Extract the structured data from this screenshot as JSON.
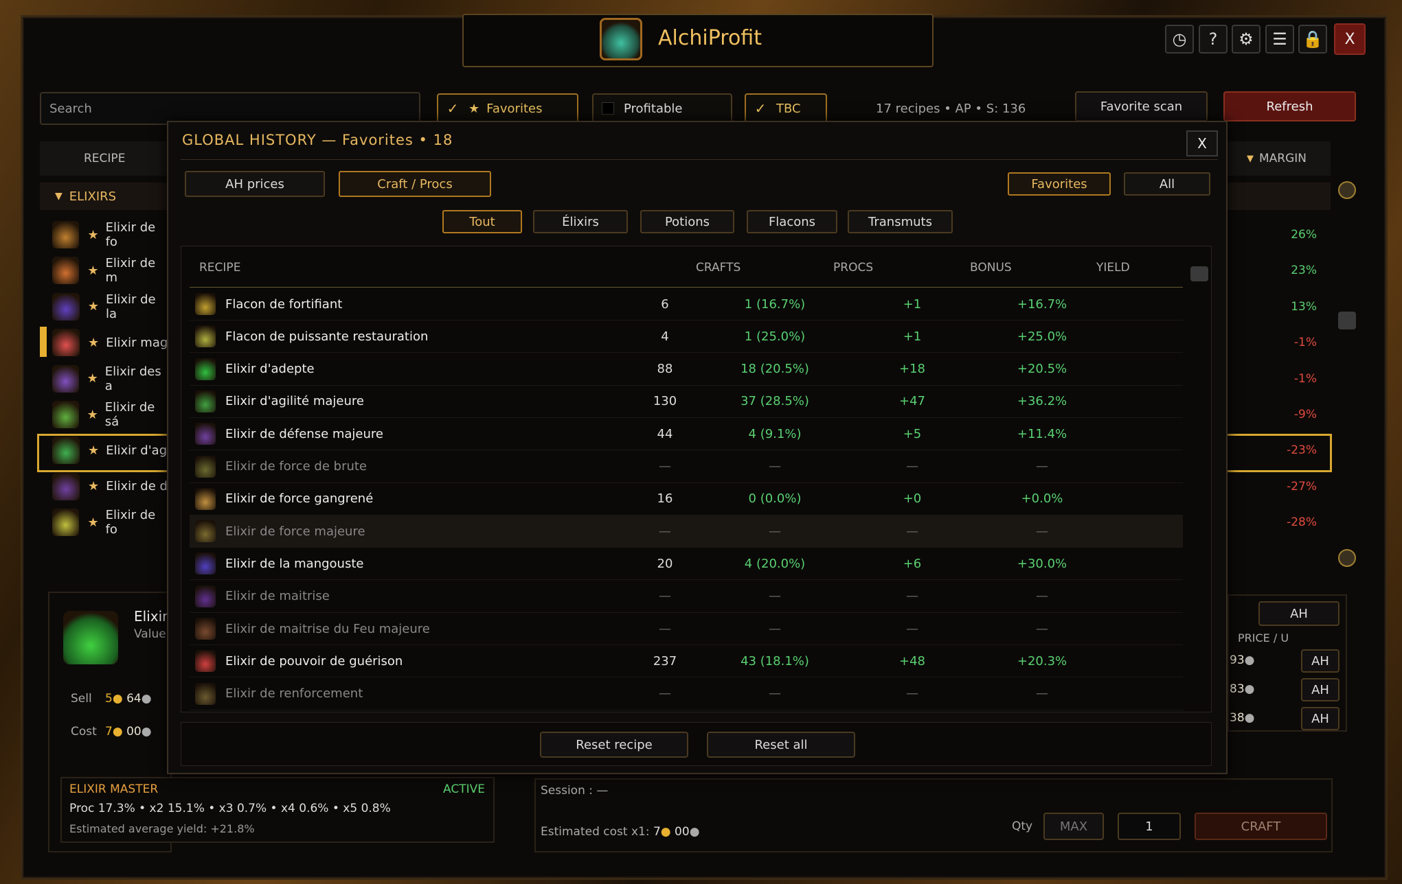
{
  "app": {
    "title": "AlchiProfit",
    "close": "X"
  },
  "toolbar": {
    "search_placeholder": "Search",
    "favorites": "Favorites",
    "profitable": "Profitable",
    "tbc": "TBC",
    "meta": "17 recipes  •  AP  •  S: 136",
    "favorite_scan": "Favorite scan",
    "refresh": "Refresh"
  },
  "list": {
    "col_recipe": "RECIPE",
    "col_margin": "MARGIN",
    "category": "ELIXIRS",
    "items": [
      {
        "label": "Elixir de fo",
        "margin": "26%",
        "icon": "#c08030"
      },
      {
        "label": "Elixir de m",
        "margin": "23%",
        "icon": "#d07030"
      },
      {
        "label": "Elixir de la",
        "margin": "13%",
        "icon": "#6040c0"
      },
      {
        "label": "Elixir mag",
        "margin": "-1%",
        "icon": "#e05050"
      },
      {
        "label": "Elixir des a",
        "margin": "-1%",
        "icon": "#8050c0"
      },
      {
        "label": "Elixir de sá",
        "margin": "-9%",
        "icon": "#60b040"
      },
      {
        "label": "Elixir d'ag",
        "margin": "-23%",
        "icon": "#40b050"
      },
      {
        "label": "Elixir de d",
        "margin": "-27%",
        "icon": "#7040a0"
      },
      {
        "label": "Elixir de fo",
        "margin": "-28%",
        "icon": "#c0c040"
      }
    ]
  },
  "detail": {
    "name": "Elixir",
    "value": "Value",
    "sell_label": "Sell",
    "sell_g": "5",
    "sell_s": "64",
    "cost_label": "Cost",
    "cost_g": "7",
    "cost_s": "00",
    "ah": "AH",
    "price_u": "PRICE / U",
    "prices": [
      "93",
      "83",
      "38"
    ],
    "ah_btn": "AH",
    "master": "ELIXIR MASTER",
    "active": "ACTIVE",
    "procs": "Proc 17.3%  •  x2 15.1%  •  x3 0.7%  •  x4 0.6%  •  x5 0.8%",
    "yield": "Estimated average yield: +21.8%",
    "session": "Session : —",
    "est_cost": "Estimated cost x1:",
    "est_g": "7",
    "est_s": "00",
    "qty": "Qty",
    "max": "MAX",
    "qty_val": "1",
    "craft": "CRAFT"
  },
  "modal": {
    "title": "GLOBAL HISTORY  —  Favorites  •  18",
    "close": "X",
    "tabs": [
      "AH prices",
      "Craft / Procs"
    ],
    "scope": [
      "Favorites",
      "All"
    ],
    "filters": [
      "Tout",
      "Élixirs",
      "Potions",
      "Flacons",
      "Transmuts"
    ],
    "cols": [
      "RECIPE",
      "CRAFTS",
      "PROCS",
      "BONUS",
      "YIELD"
    ],
    "rows": [
      {
        "name": "Flacon de fortifiant",
        "crafts": "6",
        "procs": "1 (16.7%)",
        "bonus": "+1",
        "yield": "+16.7%",
        "icon": "#c0a030",
        "dim": false
      },
      {
        "name": "Flacon de puissante restauration",
        "crafts": "4",
        "procs": "1 (25.0%)",
        "bonus": "+1",
        "yield": "+25.0%",
        "icon": "#b0b040",
        "dim": false
      },
      {
        "name": "Elixir d'adepte",
        "crafts": "88",
        "procs": "18 (20.5%)",
        "bonus": "+18",
        "yield": "+20.5%",
        "icon": "#30c040",
        "dim": false
      },
      {
        "name": "Elixir d'agilité majeure",
        "crafts": "130",
        "procs": "37 (28.5%)",
        "bonus": "+47",
        "yield": "+36.2%",
        "icon": "#40a040",
        "dim": false
      },
      {
        "name": "Elixir de défense majeure",
        "crafts": "44",
        "procs": "4 (9.1%)",
        "bonus": "+5",
        "yield": "+11.4%",
        "icon": "#7040a0",
        "dim": false
      },
      {
        "name": "Elixir de force de brute",
        "crafts": "—",
        "procs": "—",
        "bonus": "—",
        "yield": "—",
        "icon": "#6a6a30",
        "dim": true
      },
      {
        "name": "Elixir de force gangrené",
        "crafts": "16",
        "procs": "0 (0.0%)",
        "bonus": "+0",
        "yield": "+0.0%",
        "icon": "#c09040",
        "dim": false
      },
      {
        "name": "Elixir de force majeure",
        "crafts": "—",
        "procs": "—",
        "bonus": "—",
        "yield": "—",
        "icon": "#7a6a30",
        "dim": true
      },
      {
        "name": "Elixir de la mangouste",
        "crafts": "20",
        "procs": "4 (20.0%)",
        "bonus": "+6",
        "yield": "+30.0%",
        "icon": "#5040c0",
        "dim": false
      },
      {
        "name": "Elixir de maitrise",
        "crafts": "—",
        "procs": "—",
        "bonus": "—",
        "yield": "—",
        "icon": "#603090",
        "dim": true
      },
      {
        "name": "Elixir de maitrise du Feu majeure",
        "crafts": "—",
        "procs": "—",
        "bonus": "—",
        "yield": "—",
        "icon": "#7a4a30",
        "dim": true
      },
      {
        "name": "Elixir de pouvoir de guérison",
        "crafts": "237",
        "procs": "43 (18.1%)",
        "bonus": "+48",
        "yield": "+20.3%",
        "icon": "#d04040",
        "dim": false
      },
      {
        "name": "Elixir de renforcement",
        "crafts": "—",
        "procs": "—",
        "bonus": "—",
        "yield": "—",
        "icon": "#6a5a30",
        "dim": true
      }
    ],
    "reset_recipe": "Reset recipe",
    "reset_all": "Reset all"
  }
}
